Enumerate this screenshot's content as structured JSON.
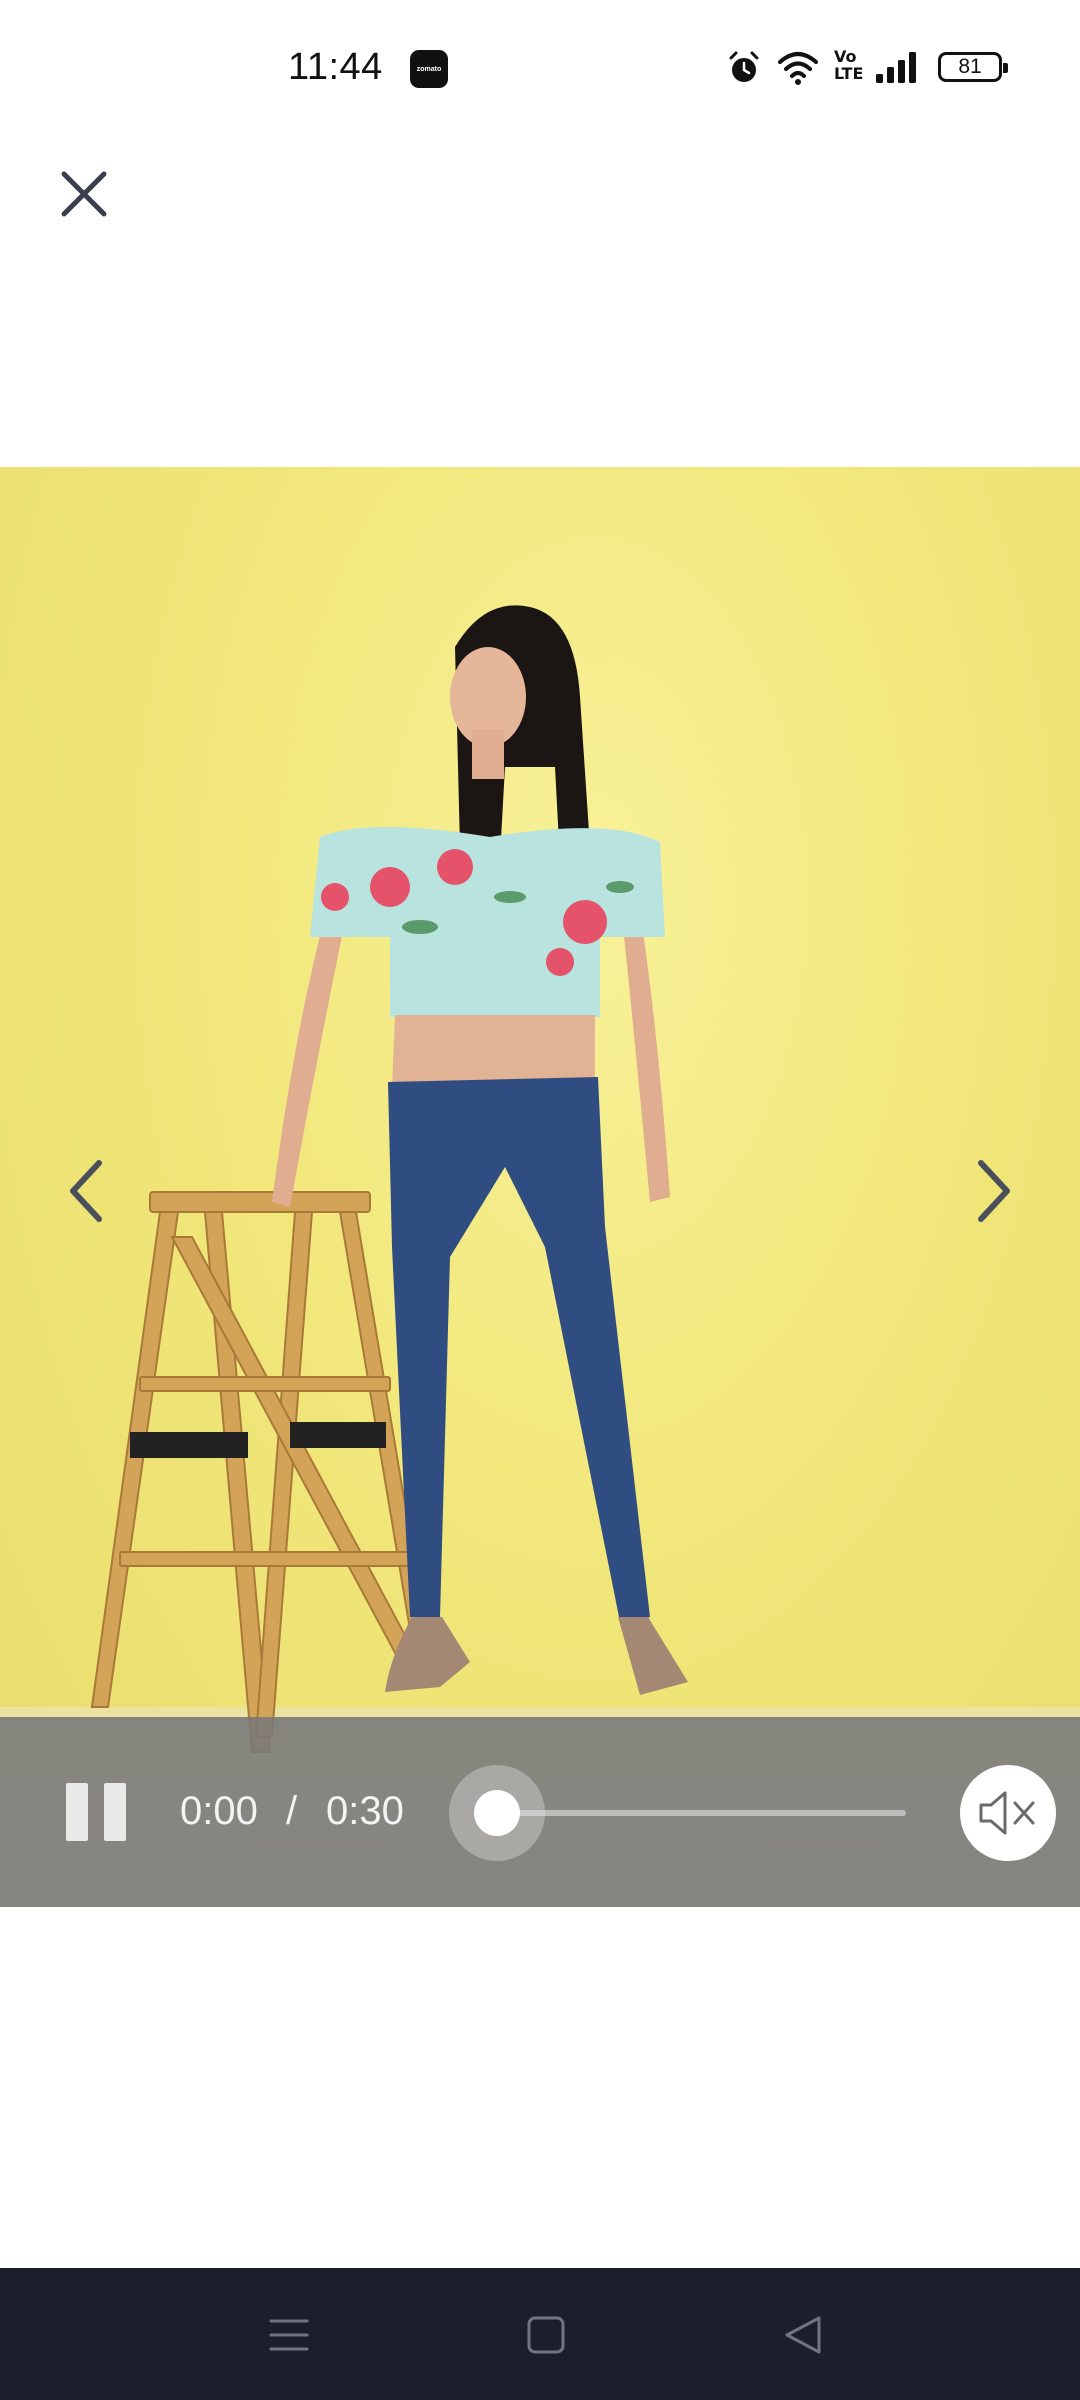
{
  "status_bar": {
    "time": "11:44",
    "app_badge": "zomato",
    "volte_top": "Vo",
    "volte_bottom": "LTE",
    "battery": "81",
    "icons": [
      "alarm-icon",
      "wifi-icon",
      "volte-icon",
      "signal-icon",
      "battery-icon"
    ]
  },
  "header": {
    "close_icon": "close-icon"
  },
  "video": {
    "current_time": "0:00",
    "separator": "/",
    "total_time": "0:30",
    "progress": 0,
    "muted": true,
    "playing": true
  },
  "colors": {
    "backdrop": "#f1e77a",
    "controls_bg": "#7a7a7a",
    "system_nav_bg": "#1c1f2b"
  }
}
